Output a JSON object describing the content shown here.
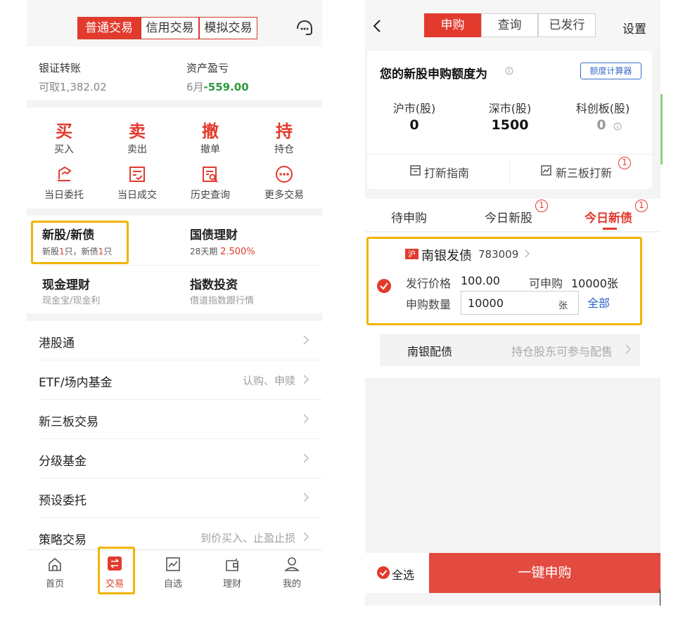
{
  "left": {
    "segments": [
      "普通交易",
      "信用交易",
      "模拟交易"
    ],
    "bank_transfer": {
      "title": "银证转账",
      "sub_prefix": "可取",
      "sub_value": "1,382.02"
    },
    "asset_pl": {
      "title": "资产盈亏",
      "sub_prefix": "6月",
      "sub_value": "-559.00"
    },
    "actions_top": [
      {
        "big": "买",
        "small": "买入"
      },
      {
        "big": "卖",
        "small": "卖出"
      },
      {
        "big": "撤",
        "small": "撤单"
      },
      {
        "big": "持",
        "small": "持仓"
      }
    ],
    "actions_bottom": [
      "当日委托",
      "当日成交",
      "历史查询",
      "更多交易"
    ],
    "ipo": {
      "title": "新股/新债",
      "sub_a": "新股",
      "count_a": "1",
      "sub_b": "只，新债",
      "count_b": "1",
      "sub_c": "只"
    },
    "treasury": {
      "title": "国债理财",
      "sub": "28天期",
      "rate": "2.500%"
    },
    "cash": {
      "title": "现金理财",
      "sub": "现金宝/现金利"
    },
    "index": {
      "title": "指数投资",
      "sub": "借道指数跟行情"
    },
    "menu": [
      {
        "label": "港股通",
        "right": ""
      },
      {
        "label": "ETF/场内基金",
        "right": "认购、申赎"
      },
      {
        "label": "新三板交易",
        "right": ""
      },
      {
        "label": "分级基金",
        "right": ""
      },
      {
        "label": "预设委托",
        "right": ""
      },
      {
        "label": "策略交易",
        "right": "到价买入、止盈止损"
      }
    ],
    "tabbar": [
      "首页",
      "交易",
      "自选",
      "理财",
      "我的"
    ]
  },
  "right": {
    "back_glyph": "<",
    "segments": [
      "申购",
      "查询",
      "已发行"
    ],
    "settings": "设置",
    "quota_title": "您的新股申购额度为",
    "calc_button": "额度计算器",
    "markets": [
      {
        "label": "沪市(股)",
        "value": "0"
      },
      {
        "label": "深市(股)",
        "value": "1500"
      },
      {
        "label": "科创板(股)",
        "value": "0"
      }
    ],
    "guide": "打新指南",
    "neeq": "新三板打新",
    "neeq_badge": "1",
    "subtabs": [
      "待申购",
      "今日新股",
      "今日新债"
    ],
    "subtab_badges": [
      "1",
      "1"
    ],
    "bond": {
      "market_tag": "沪",
      "name": "南银发债",
      "code": "783009",
      "price_label": "发行价格",
      "price": "100.00",
      "max_label": "可申购",
      "max": "10000张",
      "qty_label": "申购数量",
      "qty": "10000",
      "qty_unit": "张",
      "all": "全部"
    },
    "placement": {
      "name": "南银配债",
      "hint": "持仓股东可参与配售"
    },
    "select_all": "全选",
    "submit": "一键申购"
  },
  "colors": {
    "accent": "#e23b2e",
    "highlight": "#f0b400",
    "positive": "#2e9a3c",
    "link": "#2a62c9"
  }
}
